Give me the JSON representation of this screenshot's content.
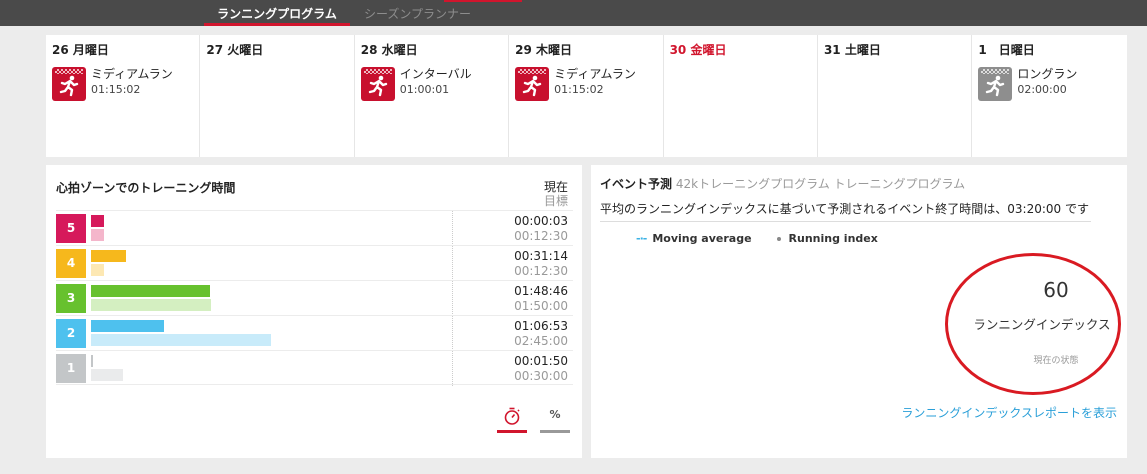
{
  "tabs": [
    {
      "label": "ランニングプログラム",
      "active": true
    },
    {
      "label": "シーズンプランナー",
      "active": false
    }
  ],
  "colors": {
    "accent": "#d1152d",
    "link": "#2a9fd8"
  },
  "week": [
    {
      "label": "26 月曜日",
      "today": false,
      "workout": {
        "name": "ミディアムラン",
        "duration": "01:15:02",
        "icon": "running-red-icon"
      }
    },
    {
      "label": "27 火曜日",
      "today": false,
      "workout": null
    },
    {
      "label": "28 水曜日",
      "today": false,
      "workout": {
        "name": "インターバル",
        "duration": "01:00:01",
        "icon": "running-red-icon"
      }
    },
    {
      "label": "29 木曜日",
      "today": false,
      "workout": {
        "name": "ミディアムラン",
        "duration": "01:15:02",
        "icon": "running-red-icon"
      }
    },
    {
      "label": "30 金曜日",
      "today": true,
      "workout": null
    },
    {
      "label": "31 土曜日",
      "today": false,
      "workout": null
    },
    {
      "label": "1　日曜日",
      "today": false,
      "workout": {
        "name": "ロングラン",
        "duration": "02:00:00",
        "icon": "running-gray-icon"
      }
    }
  ],
  "heart_zones": {
    "title": "心拍ゾーンでのトレーニング時間",
    "now_label": "現在",
    "goal_label": "目標",
    "zones": [
      {
        "num": "5",
        "color": "#d6195b",
        "light": "#f4b6cb",
        "now": "00:00:03",
        "goal": "00:12:30",
        "now_frac": 0.072,
        "goal_frac": 0.072
      },
      {
        "num": "4",
        "color": "#f6b81c",
        "light": "#fde8b3",
        "now": "00:31:14",
        "goal": "00:12:30",
        "now_frac": 0.195,
        "goal_frac": 0.072
      },
      {
        "num": "3",
        "color": "#67c12e",
        "light": "#d4efc1",
        "now": "01:48:46",
        "goal": "01:50:00",
        "now_frac": 0.66,
        "goal_frac": 0.666
      },
      {
        "num": "2",
        "color": "#4ec1ee",
        "light": "#c8ebfa",
        "now": "01:06:53",
        "goal": "02:45:00",
        "now_frac": 0.405,
        "goal_frac": 1.0
      },
      {
        "num": "1",
        "color": "#c3c6c8",
        "light": "#eaebec",
        "now": "00:01:50",
        "goal": "00:30:00",
        "now_frac": 0.011,
        "goal_frac": 0.18
      }
    ],
    "toggle_percent": "%"
  },
  "event": {
    "title": "イベント予測",
    "subtitle": "42kトレーニングプログラム トレーニングプログラム",
    "description": "平均のランニングインデックスに基づいて予測されるイベント終了時間は、03:20:00 です",
    "legend_moving": "Moving average",
    "legend_index": "Running index",
    "index_value": "60",
    "index_label": "ランニングインデックス",
    "index_status": "現在の状態",
    "report_link": "ランニングインデックスレポートを表示"
  }
}
